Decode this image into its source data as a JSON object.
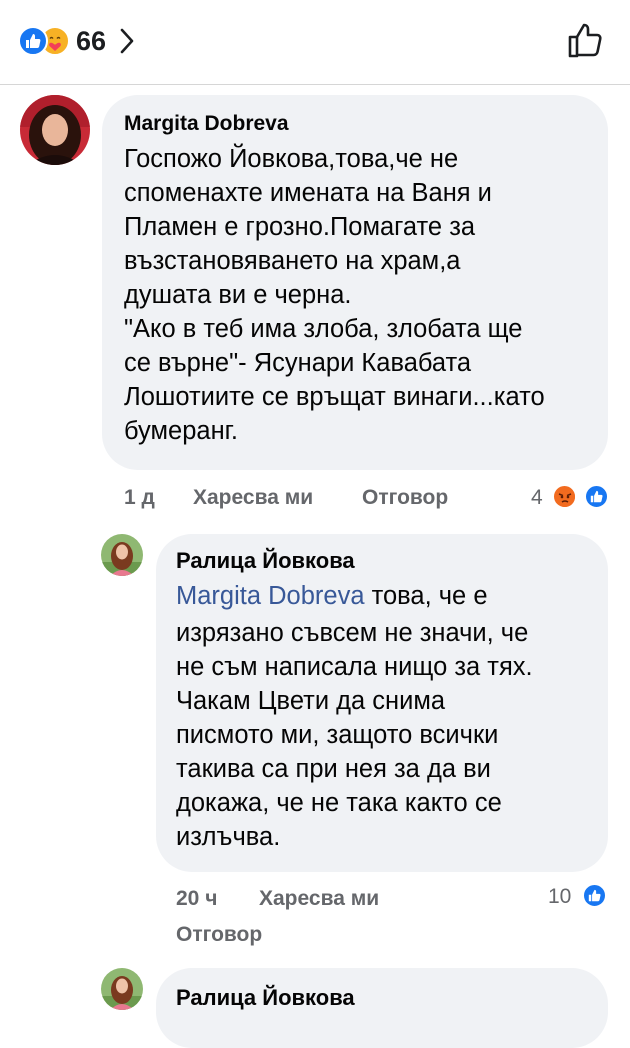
{
  "header": {
    "reaction_icons": [
      "like-icon",
      "care-icon"
    ],
    "reaction_count": "66"
  },
  "comments": [
    {
      "author": "Margita Dobreva",
      "text": "Госпожо Йовкова,това,че не\nспоменахте имената на Ваня и\nПламен е грозно.Помагате за\nвъзстановяването на храм,а\nдушата ви е черна.\n\"Ако в теб има  злоба, злобата ще\nсе върне\"- Ясунари Кавабата\nЛошотиите се връщат винаги...като\nбумеранг.",
      "time": "1 д",
      "like_label": "Харесва ми",
      "reply_label": "Отговор",
      "reaction_count": "4",
      "reaction_icons": [
        "angry-icon",
        "like-icon"
      ]
    },
    {
      "author": "Ралица Йовкова",
      "mention": "Margita Dobreva",
      "text_line1": " това, че е",
      "text": "изрязано съвсем не значи, че\nне съм написала нищо за тях.\nЧакам Цвети да снима\nписмото ми, защото всички\nтакива са при нея за да ви\nдокажа, че не така както се\nизлъчва.",
      "time": "20 ч",
      "like_label": "Харесва ми",
      "reply_label": "Отговор",
      "reaction_count": "10",
      "reaction_icons": [
        "like-icon"
      ]
    },
    {
      "author": "Ралица Йовкова"
    }
  ],
  "colors": {
    "facebook_blue": "#1877f2",
    "bubble_bg": "#f0f2f5",
    "meta_gray": "#65676b",
    "mention_blue": "#385898"
  }
}
